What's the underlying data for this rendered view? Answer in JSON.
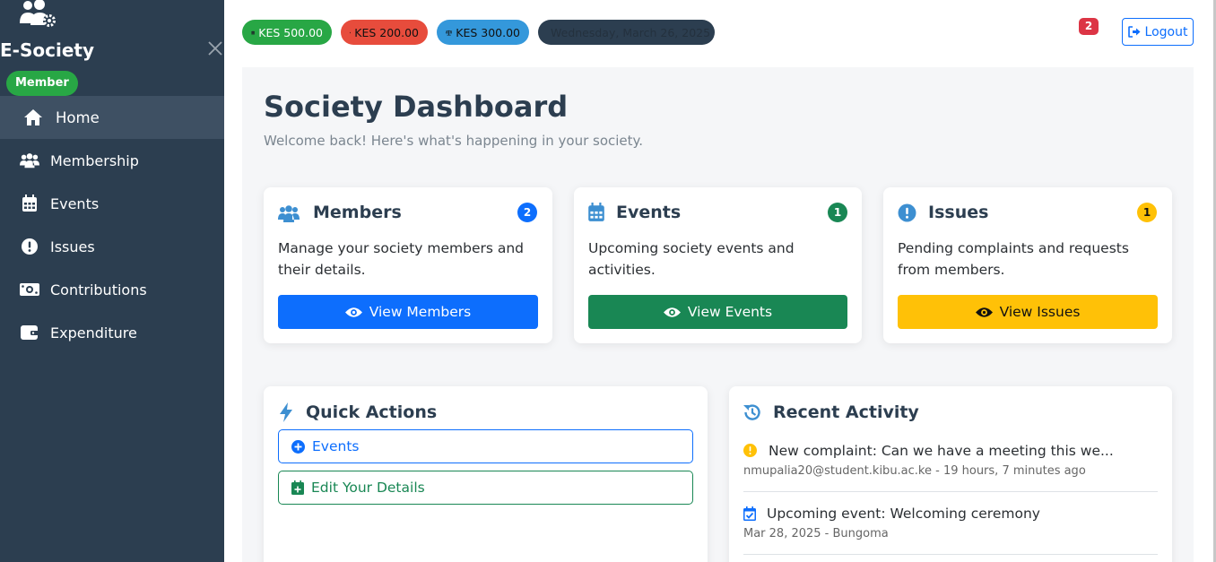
{
  "app": {
    "name": "E-Society",
    "role": "Member"
  },
  "sidebar": {
    "items": [
      {
        "label": "Home"
      },
      {
        "label": "Membership"
      },
      {
        "label": "Events"
      },
      {
        "label": "Issues"
      },
      {
        "label": "Contributions"
      },
      {
        "label": "Expenditure"
      }
    ]
  },
  "topbar": {
    "contributions": "KES 500.00",
    "expenditure": "KES 200.00",
    "balance": "KES 300.00",
    "date": "Wednesday, March 26, 2025",
    "notifications": "2",
    "logout_label": "Logout"
  },
  "page": {
    "title": "Society Dashboard",
    "subtitle": "Welcome back! Here's what's happening in your society."
  },
  "cards": {
    "members": {
      "title": "Members",
      "count": "2",
      "text": "Manage your society members and their details.",
      "button": "View Members"
    },
    "events": {
      "title": "Events",
      "count": "1",
      "text": "Upcoming society events and activities.",
      "button": "View Events"
    },
    "issues": {
      "title": "Issues",
      "count": "1",
      "text": "Pending complaints and requests from members.",
      "button": "View Issues"
    }
  },
  "quick_actions": {
    "title": "Quick Actions",
    "items": [
      {
        "label": "Events"
      },
      {
        "label": "Edit Your Details"
      }
    ]
  },
  "recent_activity": {
    "title": "Recent Activity",
    "items": [
      {
        "title": "New complaint: Can we have a meeting this we...",
        "meta": "nmupalia20@student.kibu.ac.ke - 19 hours, 7 minutes ago"
      },
      {
        "title": "Upcoming event: Welcoming ceremony",
        "meta": "Mar 28, 2025 - Bungoma"
      }
    ]
  },
  "colors": {
    "sidebar": "#2c3e50",
    "primary": "#0d6efd",
    "success": "#198754",
    "warning": "#ffc107",
    "danger": "#dc3545"
  },
  "icons": [
    "users-cog-icon",
    "close-icon",
    "home-icon",
    "users-icon",
    "calendar-icon",
    "exclamation-circle-icon",
    "money-icon",
    "wallet-icon",
    "coins-icon",
    "receipt-icon",
    "balance-scale-icon",
    "sign-out-icon",
    "eye-icon",
    "bolt-icon",
    "plus-circle-icon",
    "calendar-plus-icon",
    "history-icon",
    "calendar-check-icon"
  ]
}
